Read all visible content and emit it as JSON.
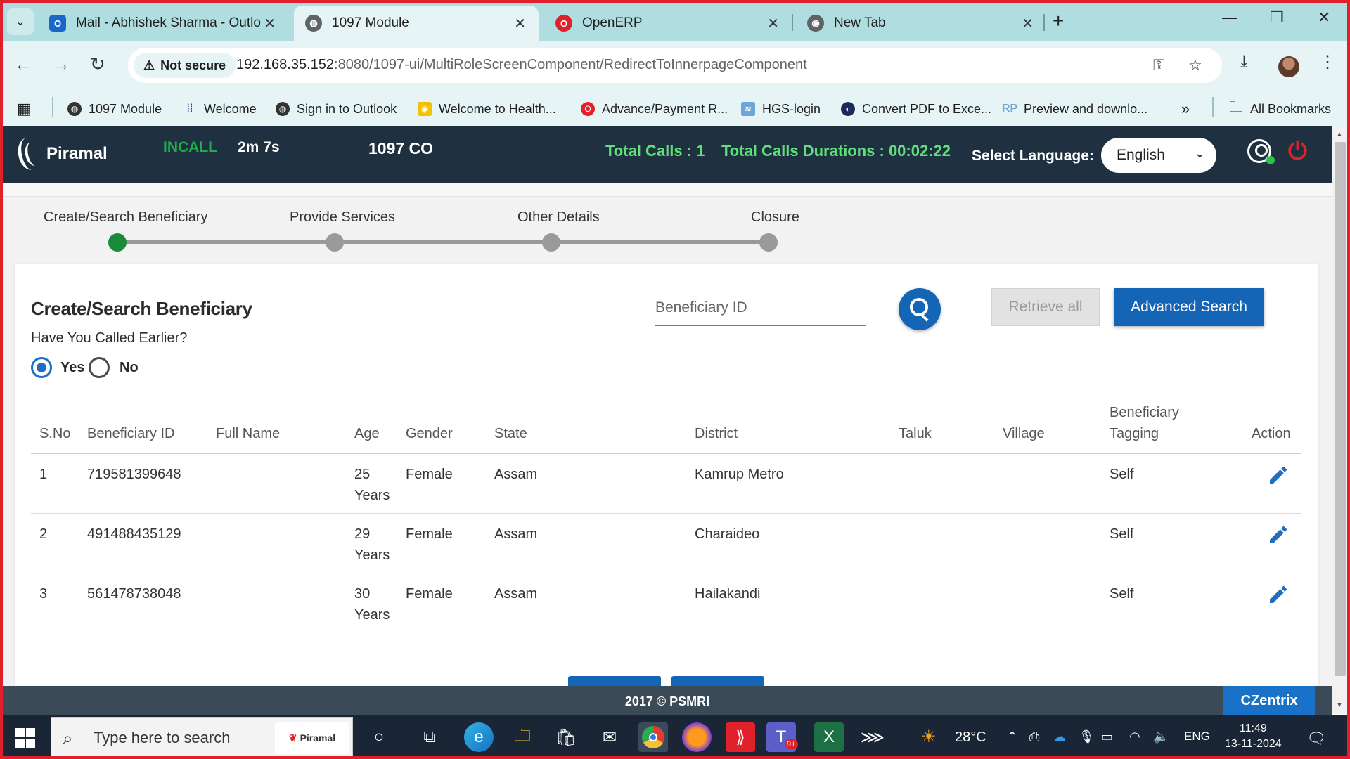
{
  "browser": {
    "tabs": [
      {
        "title": "Mail - Abhishek Sharma - Outlo",
        "icon": "outlook-icon",
        "color": "#1b67c9"
      },
      {
        "title": "1097 Module",
        "icon": "globe-icon",
        "color": "#555555",
        "active": true
      },
      {
        "title": "OpenERP",
        "icon": "opera-icon",
        "color": "#e0202a"
      },
      {
        "title": "New Tab",
        "icon": "chrome-icon",
        "color": "#555555"
      }
    ],
    "address": {
      "security_label": "Not secure",
      "host": "192.168.35.152",
      "path": ":8080/1097-ui/MultiRoleScreenComponent/RedirectToInnerpageComponent"
    },
    "bookmarks": [
      "1097 Module",
      "Welcome",
      "Sign in to Outlook",
      "Welcome to Health...",
      "Advance/Payment R...",
      "HGS-login",
      "Convert PDF to Exce...",
      "Preview and downlo..."
    ],
    "bookmarks_overflow": "»",
    "all_bookmarks": "All Bookmarks"
  },
  "header": {
    "logo_text": "Piramal",
    "call_status": "INCALL",
    "call_time": "2m 7s",
    "role": "1097 CO",
    "total_calls": "Total Calls : 1",
    "total_duration": "Total Calls Durations : 00:02:22",
    "language_label": "Select Language:",
    "language_value": "English",
    "accent_green": "#5fe07a"
  },
  "stepper": {
    "steps": [
      "Create/Search Beneficiary",
      "Provide Services",
      "Other Details",
      "Closure"
    ],
    "current": 0
  },
  "search": {
    "title": "Create/Search Beneficiary",
    "question": "Have You Called Earlier?",
    "options": [
      "Yes",
      "No"
    ],
    "selected": "Yes",
    "id_placeholder": "Beneficiary ID",
    "retrieve_label": "Retrieve all",
    "advanced_label": "Advanced Search"
  },
  "table": {
    "headers": [
      "S.No",
      "Beneficiary ID",
      "Full Name",
      "Age",
      "Gender",
      "State",
      "District",
      "Taluk",
      "Village",
      "Beneficiary",
      "Tagging",
      "Action"
    ],
    "rows": [
      {
        "sno": "1",
        "id": "719581399648",
        "name": "",
        "age": "25",
        "age_unit": "Years",
        "gender": "Female",
        "state": "Assam",
        "district": "Kamrup Metro",
        "taluk": "",
        "village": "",
        "tagging": "Self"
      },
      {
        "sno": "2",
        "id": "491488435129",
        "name": "",
        "age": "29",
        "age_unit": "Years",
        "gender": "Female",
        "state": "Assam",
        "district": "Charaideo",
        "taluk": "",
        "village": "",
        "tagging": "Self"
      },
      {
        "sno": "3",
        "id": "561478738048",
        "name": "",
        "age": "30",
        "age_unit": "Years",
        "gender": "Female",
        "state": "Assam",
        "district": "Hailakandi",
        "taluk": "",
        "village": "",
        "tagging": "Self"
      }
    ]
  },
  "footer": {
    "copyright": "2017 © PSMRI",
    "czentrix": "CZentrix"
  },
  "taskbar": {
    "search_placeholder": "Type here to search",
    "search_brand": "Piramal",
    "weather": "28°C",
    "lang": "ENG",
    "time": "11:49",
    "date": "13-11-2024",
    "teams_badge": "9+"
  }
}
